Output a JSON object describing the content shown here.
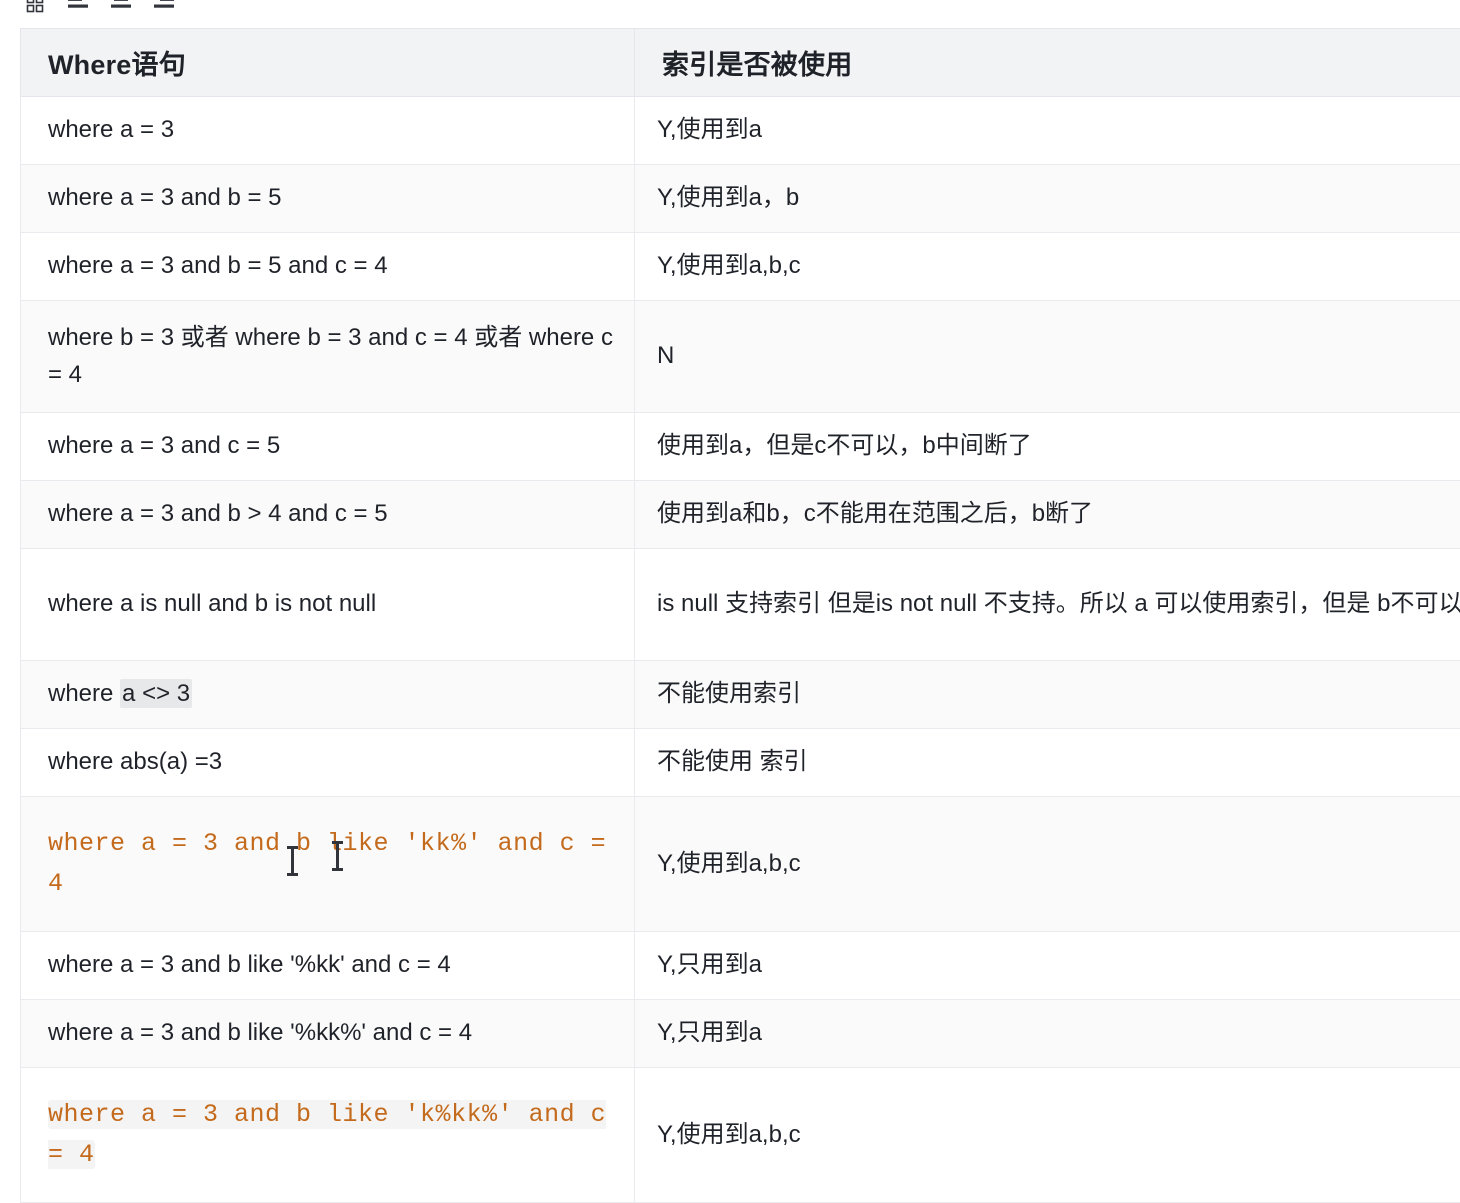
{
  "toolbar": {
    "buttons": [
      {
        "name": "table-grid-icon",
        "label": "Table"
      },
      {
        "name": "align-left-icon",
        "label": "Align left"
      },
      {
        "name": "align-center-icon",
        "label": "Align center"
      },
      {
        "name": "align-right-icon",
        "label": "Align right"
      }
    ]
  },
  "table": {
    "headers": [
      "Where语句",
      "索引是否被使用"
    ],
    "rows": [
      {
        "where": "where a = 3",
        "where_style": "plain",
        "result": "Y,使用到a"
      },
      {
        "where": "where a = 3 and b = 5",
        "where_style": "plain",
        "result": "Y,使用到a，b"
      },
      {
        "where": "where a = 3 and b = 5 and c = 4",
        "where_style": "plain",
        "result": "Y,使用到a,b,c"
      },
      {
        "where": "where b = 3 或者 where b = 3 and c = 4 或者 where c = 4",
        "where_style": "plain",
        "result": "N"
      },
      {
        "where": "where a = 3 and c = 5",
        "where_style": "plain",
        "result": "使用到a，但是c不可以，b中间断了"
      },
      {
        "where": "where a = 3 and b > 4 and c = 5",
        "where_style": "plain",
        "result": "使用到a和b，c不能用在范围之后，b断了"
      },
      {
        "where": "where a is  null and b is not null",
        "where_style": "plain",
        "result": "is null 支持索引 但是is not null 不支持。所以 a 可以使用索引，但是 b不可以使用"
      },
      {
        "where_prefix": "where ",
        "where_highlight": "a <> 3",
        "where_style": "highlight",
        "result": "不能使用索引"
      },
      {
        "where": "where  abs(a) =3",
        "where_style": "plain",
        "result": "不能使用 索引"
      },
      {
        "where": " where a =  3 and b like 'kk%' and c = 4",
        "where_style": "code",
        "result": "Y,使用到a,b,c"
      },
      {
        "where": "where a = 3 and b like '%kk' and c = 4",
        "where_style": "plain",
        "result": "Y,只用到a"
      },
      {
        "where": "where a = 3 and b like '%kk%' and c = 4",
        "where_style": "plain",
        "result": "Y,只用到a"
      },
      {
        "where": " where a =  3 and b like 'k%kk%' and c =  4",
        "where_style": "code-bg",
        "result": "Y,使用到a,b,c"
      }
    ]
  },
  "colors": {
    "header_bg": "#f2f3f5",
    "stripe_bg": "#fafafa",
    "border": "#e8eaed",
    "code_text": "#c46a1c",
    "highlight_bg": "#e7e8ea",
    "text": "#1f2329"
  }
}
